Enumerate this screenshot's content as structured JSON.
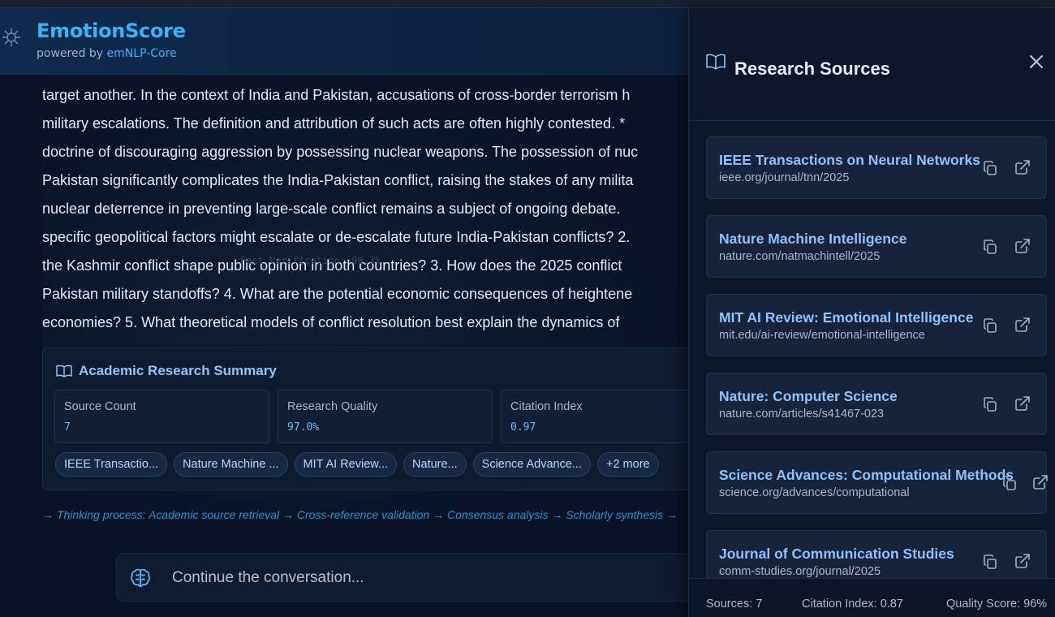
{
  "app": {
    "title": "EmotionScore",
    "subtitle_prefix": "powered by",
    "subtitle_link": "emNLP-Core"
  },
  "message": {
    "lines": [
      "target another. In the context of India and Pakistan, accusations of cross-border terrorism h",
      "military escalations. The definition and attribution of such acts are often highly contested. *",
      "doctrine of discouraging aggression by possessing nuclear weapons. The possession of nuc",
      "Pakistan significantly complicates the India-Pakistan conflict, raising the stakes of any milita",
      "nuclear deterrence in preventing large-scale conflict remains a subject of ongoing debate.",
      "specific geopolitical factors might escalate or de-escalate future India-Pakistan conflicts? 2.",
      "the Kashmir conflict shape public opinion in both countries? 3. How does the 2025 conflict",
      "Pakistan military standoffs? 4. What are the potential economic consequences of heightene",
      "economies? 5. What theoretical models of conflict resolution best explain the dynamics of"
    ],
    "ghost_text": "Fact Verification: 90.3%"
  },
  "summary": {
    "title": "Academic Research Summary",
    "stats": [
      {
        "label": "Source Count",
        "value": "7"
      },
      {
        "label": "Research Quality",
        "value": "97.0%"
      },
      {
        "label": "Citation Index",
        "value": "0.97"
      }
    ],
    "chips": [
      "IEEE Transactio...",
      "Nature Machine ...",
      "MIT AI Review...",
      "Nature...",
      "Science Advance...",
      "+2 more"
    ]
  },
  "thinking": "→ Thinking process: Academic source retrieval → Cross-reference validation → Consensus analysis → Scholarly synthesis →",
  "composer": {
    "placeholder": "Continue the conversation..."
  },
  "panel": {
    "title": "Research Sources",
    "sources": [
      {
        "name": "IEEE Transactions on Neural Networks",
        "url": "ieee.org/journal/tnn/2025"
      },
      {
        "name": "Nature Machine Intelligence",
        "url": "nature.com/natmachintell/2025"
      },
      {
        "name": "MIT AI Review: Emotional Intelligence",
        "url": "mit.edu/ai-review/emotional-intelligence"
      },
      {
        "name": "Nature: Computer Science",
        "url": "nature.com/articles/s41467-023"
      },
      {
        "name": "Science Advances: Computational Methods",
        "url": "science.org/advances/computational"
      },
      {
        "name": "Journal of Communication Studies",
        "url": "comm-studies.org/journal/2025"
      }
    ],
    "footer": {
      "sources": "Sources: 7",
      "citation": "Citation Index: 0.87",
      "quality": "Quality Score: 96%"
    }
  },
  "colors": {
    "accent": "#31b7ff",
    "link": "#8ec2ff",
    "background": "#0b1426"
  }
}
